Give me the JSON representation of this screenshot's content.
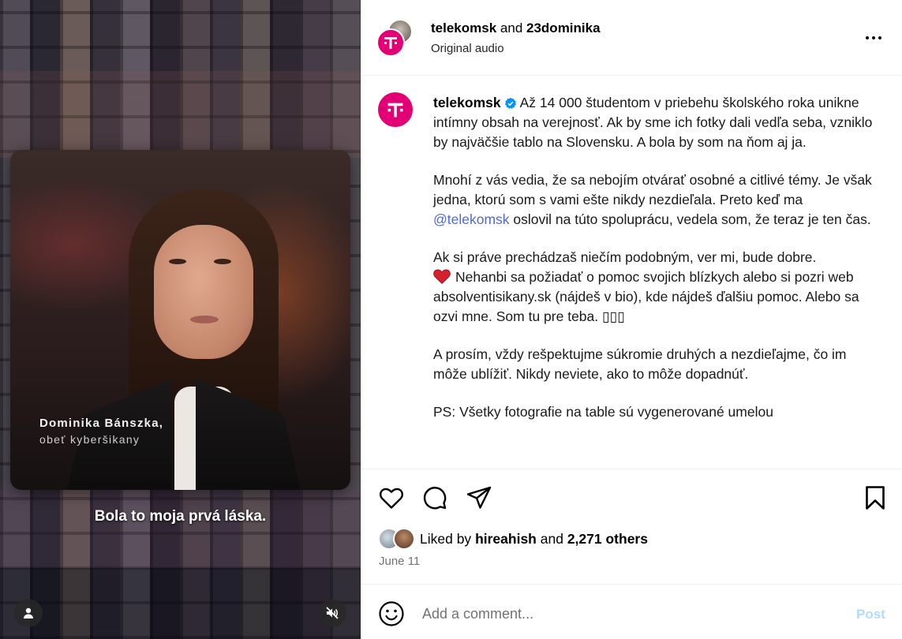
{
  "media": {
    "overlay_name": "Dominika Bánszka,",
    "overlay_role": "obeť kyberšikany",
    "subtitle": "Bola to moja prvá láska."
  },
  "header": {
    "account1": "telekomsk",
    "joiner": "and",
    "account2": "23dominika",
    "audio": "Original audio"
  },
  "caption": {
    "username": "telekomsk",
    "p1": "Až 14 000 študentom v priebehu školského roka unikne intímny obsah na verejnosť. Ak by sme ich fotky dali vedľa seba, vzniklo by najväčšie tablo na Slovensku. A bola by som na ňom aj ja.",
    "p2_before": "Mnohí z vás vedia, že sa nebojím otvárať osobné a citlivé témy. Je však jedna, ktorú som s vami ešte nikdy nezdieľala. Preto keď ma ",
    "p2_mention": "@telekomsk",
    "p2_after": " oslovil na túto spoluprácu, vedela som, že teraz je ten čas.",
    "p3_line1": "Ak si práve prechádzaš niečím podobným, ver mi, bude dobre.",
    "p3_rest": "Nehanbi sa požiadať o pomoc svojich blízkych alebo si pozri web absolventisikany.sk (nájdeš v bio), kde nájdeš ďalšiu pomoc. Alebo sa ozvi mne. Som tu pre teba. ▯▯▯",
    "p4": "A prosím, vždy rešpektujme súkromie druhých a nezdieľajme, čo im môže ublížiť. Nikdy neviete, ako to môže dopadnúť.",
    "p5": "PS: Všetky fotografie na table sú vygenerované umelou"
  },
  "likes": {
    "prefix": "Liked by",
    "user": "hireahish",
    "joiner": "and",
    "others": "2,271 others"
  },
  "date": "June 11",
  "comment": {
    "placeholder": "Add a comment...",
    "post_label": "Post"
  },
  "colors": {
    "brand_magenta": "#e20074",
    "verified_blue": "#0095f6",
    "mention_blue": "#4f6ad8",
    "post_disabled": "#b3dbff",
    "heart_red": "#d6202d"
  },
  "icons": [
    "like-icon",
    "comment-icon",
    "share-icon",
    "save-icon",
    "more-icon",
    "emoji-icon",
    "user-icon",
    "mute-icon",
    "verified-icon",
    "heart-emoji-icon"
  ]
}
